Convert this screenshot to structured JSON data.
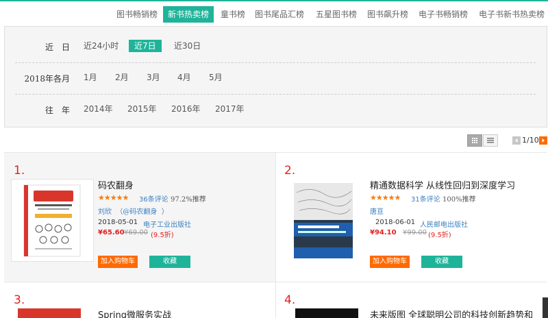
{
  "tabs": [
    {
      "label": "图书畅销榜"
    },
    {
      "label": "新书热卖榜"
    },
    {
      "label": "童书榜"
    },
    {
      "label": "图书尾品汇榜"
    },
    {
      "label": "五星图书榜"
    },
    {
      "label": "图书飙升榜"
    },
    {
      "label": "电子书畅销榜"
    },
    {
      "label": "电子书新书热卖榜"
    }
  ],
  "filters": {
    "recent": {
      "label": "近　日",
      "options": [
        "近24小时",
        "近7日",
        "近30日"
      ],
      "selected": "近7日"
    },
    "month": {
      "label": "2018年各月",
      "options": [
        "1月",
        "2月",
        "3月",
        "4月",
        "5月"
      ]
    },
    "year": {
      "label": "往　年",
      "options": [
        "2014年",
        "2015年",
        "2016年",
        "2017年"
      ]
    }
  },
  "pager": {
    "text": "1/10"
  },
  "colors": {
    "accent": "#1fb49a",
    "cart": "#ff6a00",
    "rank": "#e02020",
    "link": "#3a7fc1"
  },
  "products": [
    {
      "rank": "1.",
      "title": "码农翻身",
      "stars": "★★★★★",
      "reviews": "36条评论",
      "recommend": "97.2%推荐",
      "author": "刘欣  （@码农翻身  ）",
      "date": "2018-05-01",
      "publisher": "电子工业出版社",
      "price": "¥65.60",
      "original_price": "¥69.00",
      "discount": "(9.5折)",
      "cart_label": "加入购物车",
      "fav_label": "收藏"
    },
    {
      "rank": "2.",
      "title": "精通数据科学 从线性回归到深度学习",
      "stars": "★★★★★",
      "reviews": "31条评论",
      "recommend": "100%推荐",
      "author": "唐亘",
      "date": "2018-06-01",
      "publisher": "人民邮电出版社",
      "price": "¥94.10",
      "original_price": "¥99.00",
      "discount": "(9.5折)",
      "cart_label": "加入购物车",
      "fav_label": "收藏"
    },
    {
      "rank": "3.",
      "title": "Spring微服务实战"
    },
    {
      "rank": "4.",
      "title": "未来版图 全球聪明公司的科技创新趋势和"
    }
  ]
}
